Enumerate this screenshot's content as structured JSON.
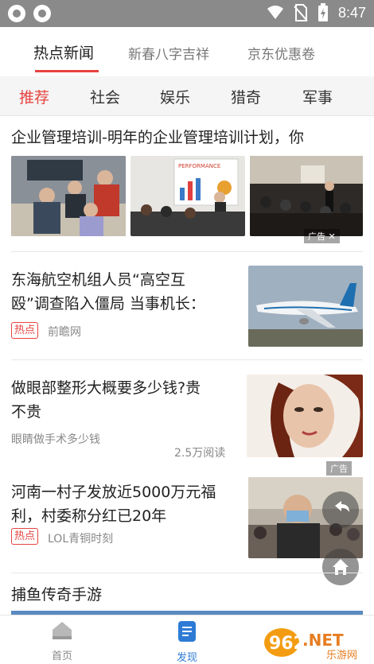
{
  "status": {
    "time": "8:47"
  },
  "top_tabs": [
    {
      "label": "热点新闻",
      "active": true
    },
    {
      "label": "新春八字吉祥"
    },
    {
      "label": "京东优惠卷"
    }
  ],
  "categories": [
    {
      "label": "推荐",
      "active": true
    },
    {
      "label": "社会"
    },
    {
      "label": "娱乐"
    },
    {
      "label": "猎奇"
    },
    {
      "label": "军事"
    }
  ],
  "feed": {
    "item1": {
      "title": "企业管理培训-明年的企业管理培训计划，你",
      "ad": "广告",
      "performance_text": "PERFORMANCE"
    },
    "item2": {
      "title_line1": "东海航空机组人员“高空互",
      "title_line2": "殴”调查陷入僵局 当事机长：",
      "tag": "热点",
      "source": "前瞻网"
    },
    "item3": {
      "title_line1": "做眼部整形大概要多少钱?贵",
      "title_line2": "不贵",
      "source": "眼睛做手术多少钱",
      "reads": "2.5万阅读",
      "ad": "广告"
    },
    "item4": {
      "title_line1": "河南一村子发放近5000万元福",
      "title_line2": "利，村委称分红已20年",
      "tag": "热点",
      "source": "LOL青铜时刻"
    },
    "item5": {
      "title": "捕鱼传奇手游"
    }
  },
  "bottom_nav": [
    {
      "label": "首页",
      "icon": "home-icon",
      "active": false
    },
    {
      "label": "发现",
      "icon": "document-icon",
      "active": true
    }
  ],
  "watermark": {
    "text": "962.NET",
    "sub": "乐游网"
  },
  "colors": {
    "accent": "#e64340",
    "active_blue": "#2e7bd6"
  }
}
